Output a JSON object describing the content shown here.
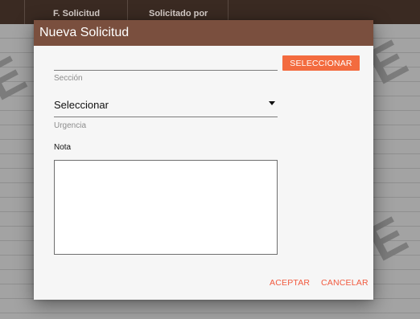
{
  "table": {
    "columns": [
      "F. Solicitud",
      "Solicitado por"
    ]
  },
  "dialog": {
    "title": "Nueva Solicitud",
    "section": {
      "label": "Sección",
      "value": "",
      "button_label": "SELECCIONAR"
    },
    "urgency": {
      "label": "Urgencia",
      "selected": "Seleccionar"
    },
    "note": {
      "label": "Nota",
      "value": ""
    },
    "actions": {
      "accept_label": "ACEPTAR",
      "cancel_label": "CANCELAR"
    }
  },
  "colors": {
    "dialog_header": "#7a4f3e",
    "accent": "#f36b3f",
    "action_text": "#f15a3f"
  },
  "icons": {
    "dropdown": "caret-down-icon"
  }
}
